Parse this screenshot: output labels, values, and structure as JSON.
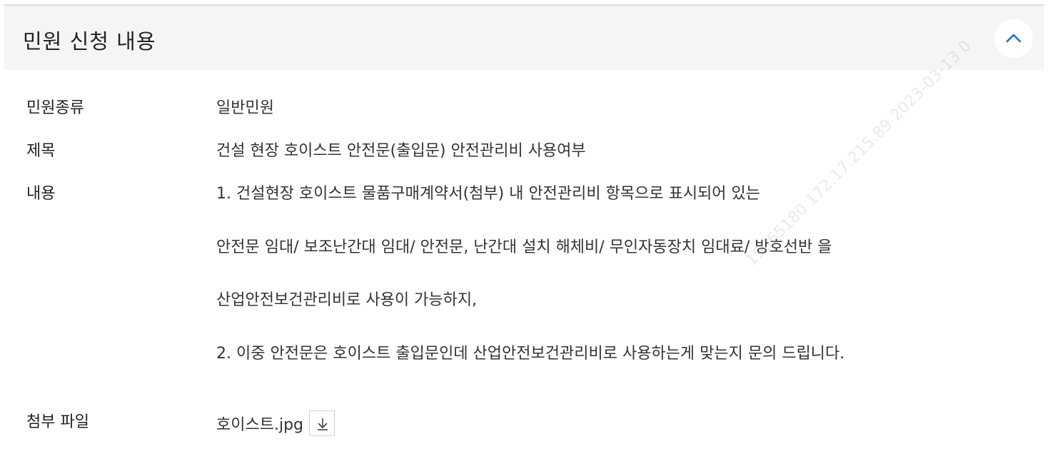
{
  "header": {
    "title": "민원 신청 내용",
    "collapse_icon": "chevron-up-icon"
  },
  "details": {
    "type_label": "민원종류",
    "type_value": "일반민원",
    "title_label": "제목",
    "title_value": "건설 현장 호이스트 안전문(출입문) 안전관리비 사용여부",
    "content_label": "내용",
    "content_lines": [
      "1. 건설현장 호이스트 물품구매계약서(첨부) 내 안전관리비 항목으로 표시되어 있는",
      "안전문 임대/ 보조난간대 임대/ 안전문, 난간대 설치 해체비/ 무인자동장치 임대료/ 방호선반 을",
      "산업안전보건관리비로 사용이 가능하지,",
      "2. 이중 안전문은 호이스트 출입문인데 산업안전보건관리비로 사용하는게 맞는지 문의 드립니다."
    ],
    "attachment_label": "첨부 파일",
    "attachment_name": "호이스트.jpg",
    "download_icon": "download-icon"
  },
  "watermark": "19065180 172.17.215.89 2023-03-13 0"
}
